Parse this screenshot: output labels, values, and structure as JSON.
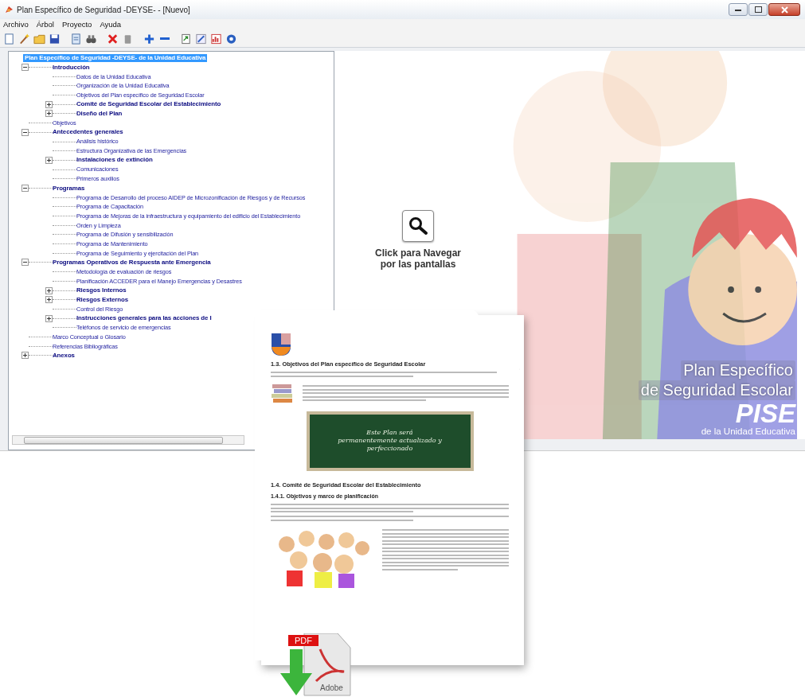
{
  "window": {
    "title": "Plan Específico de Seguridad -DEYSE- - [Nuevo]"
  },
  "menu": [
    "Archivo",
    "Árbol",
    "Proyecto",
    "Ayuda"
  ],
  "tree": {
    "label": "Plan Específico de Seguridad -DEYSE- de la Unidad Educativa",
    "kind": "root",
    "selected": true,
    "children": [
      {
        "label": "Introducción",
        "kind": "section",
        "selected": false,
        "expanded": true,
        "children": [
          {
            "label": "Datos de la Unidad Educativa",
            "kind": "page",
            "selected": false
          },
          {
            "label": "Organización de la Unidad Educativa",
            "kind": "page",
            "selected": false
          },
          {
            "label": "Objetivos del Plan específico de Seguridad Escolar",
            "kind": "page",
            "selected": false
          },
          {
            "label": "Comité de Seguridad Escolar del Establecimiento",
            "kind": "section",
            "selected": false,
            "expanded": false
          },
          {
            "label": "Diseño del Plan",
            "kind": "section",
            "selected": false,
            "expanded": false
          }
        ]
      },
      {
        "label": "Objetivos",
        "kind": "page",
        "selected": false
      },
      {
        "label": "Antecedentes generales",
        "kind": "section",
        "selected": false,
        "expanded": true,
        "children": [
          {
            "label": "Análisis histórico",
            "kind": "page",
            "selected": false
          },
          {
            "label": "Estructura Organizativa de las Emergencias",
            "kind": "page",
            "selected": false
          },
          {
            "label": "Instalaciones de extinción",
            "kind": "section",
            "selected": false,
            "expanded": false
          },
          {
            "label": "Comunicaciones",
            "kind": "page",
            "selected": false
          },
          {
            "label": "Primeros auxilios",
            "kind": "page",
            "selected": false
          }
        ]
      },
      {
        "label": "Programas",
        "kind": "section",
        "selected": false,
        "expanded": true,
        "children": [
          {
            "label": "Programa de Desarrollo del proceso AIDEP de Microzonificación de Riesgos y de Recursos",
            "kind": "page",
            "selected": false
          },
          {
            "label": "Programa de Capacitación",
            "kind": "page",
            "selected": false
          },
          {
            "label": "Programa de Mejoras de la infraestructura y equipamiento del edificio del Establecimiento",
            "kind": "page",
            "selected": false
          },
          {
            "label": "Orden y Limpieza",
            "kind": "page",
            "selected": false
          },
          {
            "label": "Programa de Difusión y sensibilización",
            "kind": "page",
            "selected": false
          },
          {
            "label": "Programa de Mantenimiento",
            "kind": "page",
            "selected": false
          },
          {
            "label": "Programa de Seguimiento y ejercitación del Plan",
            "kind": "page",
            "selected": false
          }
        ]
      },
      {
        "label": "Programas Operativos de Respuesta ante Emergencia",
        "kind": "section",
        "selected": false,
        "expanded": true,
        "children": [
          {
            "label": "Metodología de evaluación de riesgos",
            "kind": "page",
            "selected": false
          },
          {
            "label": "Planificación ACCEDER para el Manejo Emergencias y Desastres",
            "kind": "page",
            "selected": false
          },
          {
            "label": "Riesgos Internos",
            "kind": "section",
            "selected": false,
            "expanded": false
          },
          {
            "label": "Riesgos Externos",
            "kind": "section",
            "selected": false,
            "expanded": false
          },
          {
            "label": "Control del Riesgo",
            "kind": "page",
            "selected": false
          },
          {
            "label": "Instrucciones generales para las acciones de I",
            "kind": "section",
            "selected": false,
            "expanded": false
          },
          {
            "label": "Teléfonos de servicio de emergencias",
            "kind": "page",
            "selected": false
          }
        ]
      },
      {
        "label": "Marco Conceptual o Glosario",
        "kind": "page",
        "selected": false
      },
      {
        "label": "Referencias Bibliográficas",
        "kind": "page",
        "selected": false
      },
      {
        "label": "Anexos",
        "kind": "section",
        "selected": false,
        "expanded": false
      }
    ]
  },
  "navigator": {
    "caption_lines": [
      "Click para Navegar",
      "por las pantallas"
    ]
  },
  "banner": {
    "lines": [
      "Plan Específico",
      "de Seguridad Escolar"
    ],
    "acronym": "PISE",
    "subtitle": "de la Unidad Educativa"
  },
  "document_preview": {
    "heading_1": "1.3. Objetivos del Plan específico de Seguridad Escolar",
    "chalkboard": "Este Plan será permanentemente actualizado y perfeccionado",
    "heading_2": "1.4. Comité de Seguridad Escolar del Establecimiento",
    "subheading": "1.4.1. Objetivos y marco de planificación"
  },
  "pdf_icon": {
    "label": "PDF",
    "brand": "Adobe"
  }
}
